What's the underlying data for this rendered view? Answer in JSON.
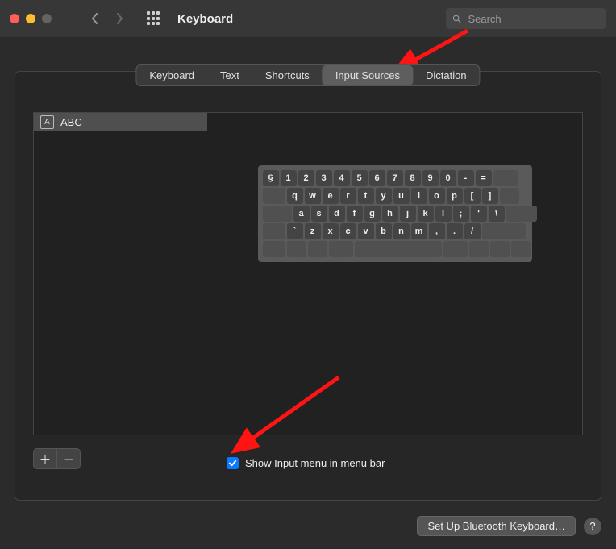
{
  "title": "Keyboard",
  "search_placeholder": "Search",
  "tabs": [
    "Keyboard",
    "Text",
    "Shortcuts",
    "Input Sources",
    "Dictation"
  ],
  "active_tab_index": 3,
  "sources": [
    {
      "icon_letter": "A",
      "name": "ABC"
    }
  ],
  "kb_rows": [
    {
      "lead_w": 0,
      "keys": [
        "§",
        "1",
        "2",
        "3",
        "4",
        "5",
        "6",
        "7",
        "8",
        "9",
        "0",
        "-",
        "="
      ],
      "tail_w": 30
    },
    {
      "lead_w": 28,
      "keys": [
        "q",
        "w",
        "e",
        "r",
        "t",
        "y",
        "u",
        "i",
        "o",
        "p",
        "[",
        "]"
      ],
      "tail_w": 24
    },
    {
      "lead_w": 36,
      "keys": [
        "a",
        "s",
        "d",
        "f",
        "g",
        "h",
        "j",
        "k",
        "l",
        ";",
        "'",
        "\\"
      ],
      "tail_w": 38
    },
    {
      "lead_w": 28,
      "keys": [
        "`",
        "z",
        "x",
        "c",
        "v",
        "b",
        "n",
        "m",
        ",",
        ".",
        "/"
      ],
      "tail_w": 54
    },
    {
      "lead_w": 0,
      "spans": [
        28,
        24,
        24,
        30,
        108,
        30,
        24,
        24,
        24
      ],
      "tail_w": 0
    }
  ],
  "checkbox_label": "Show Input menu in menu bar",
  "checkbox_checked": true,
  "footer_button": "Set Up Bluetooth Keyboard…",
  "help_label": "?"
}
